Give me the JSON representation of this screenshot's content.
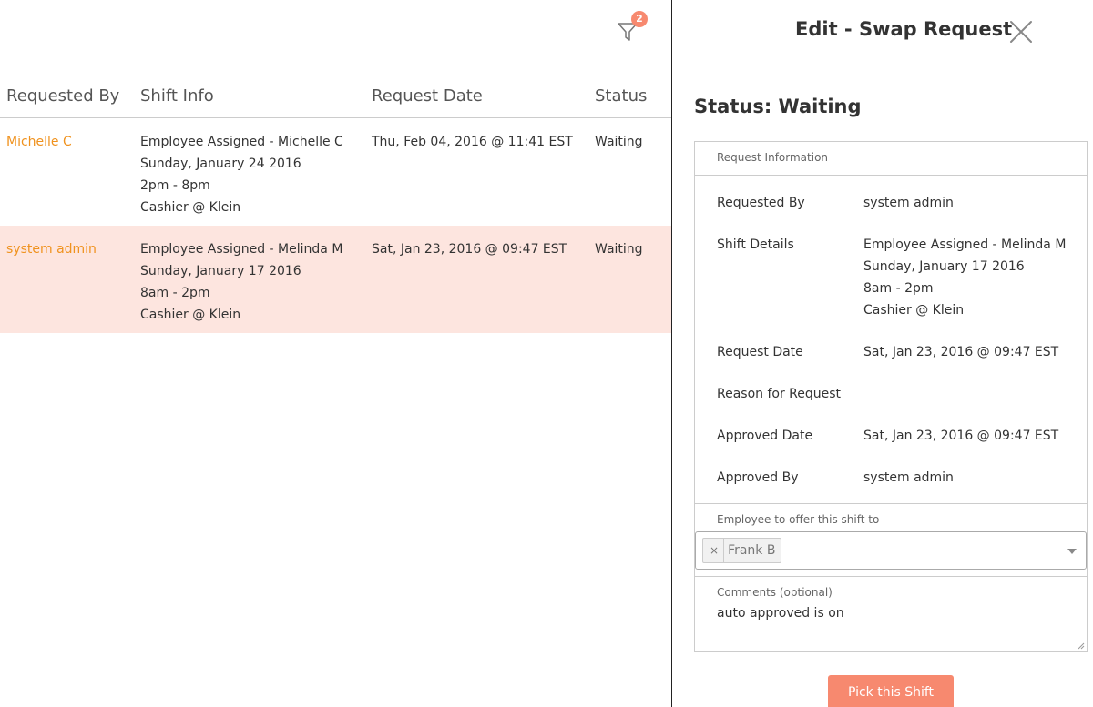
{
  "filter": {
    "icon": "filter-icon",
    "badge_count": "2",
    "badge_color": "#f7896f"
  },
  "table": {
    "headers": [
      "Requested By",
      "Shift Info",
      "Request Date",
      "Status"
    ],
    "rows": [
      {
        "requested_by": "Michelle C",
        "shift_info": [
          "Employee Assigned - Michelle C",
          "Sunday, January 24 2016",
          "2pm - 8pm",
          "Cashier @ Klein"
        ],
        "request_date": "Thu, Feb 04, 2016 @ 11:41 EST",
        "status": "Waiting"
      },
      {
        "requested_by": "system admin",
        "shift_info": [
          "Employee Assigned - Melinda M",
          "Sunday, January 17 2016",
          "8am - 2pm",
          "Cashier @ Klein"
        ],
        "request_date": "Sat, Jan 23, 2016 @ 09:47 EST",
        "status": "Waiting",
        "selected": true
      }
    ]
  },
  "panel": {
    "title": "Edit - Swap Request",
    "close_icon": "close-icon",
    "status_heading": "Status: Waiting",
    "info_header": "Request Information",
    "fields": {
      "requested_by": {
        "label": "Requested By",
        "value": "system admin"
      },
      "shift_details": {
        "label": "Shift Details",
        "value": [
          "Employee Assigned - Melinda M",
          "Sunday, January 17 2016",
          "8am - 2pm",
          "Cashier @ Klein"
        ]
      },
      "request_date": {
        "label": "Request Date",
        "value": "Sat, Jan 23, 2016 @ 09:47 EST"
      },
      "reason": {
        "label": "Reason for Request",
        "value": ""
      },
      "approved_date": {
        "label": "Approved Date",
        "value": "Sat, Jan 23, 2016 @ 09:47 EST"
      },
      "approved_by": {
        "label": "Approved By",
        "value": "system admin"
      }
    },
    "offer": {
      "label": "Employee to offer this shift to",
      "selected_tag": "Frank B",
      "remove_glyph": "×"
    },
    "comments": {
      "label": "Comments (optional)",
      "value": "auto approved is on"
    },
    "pick_button": "Pick this Shift",
    "accent_color": "#f7896f",
    "link_color": "#f0921e",
    "selected_row_color": "#fde5df"
  }
}
